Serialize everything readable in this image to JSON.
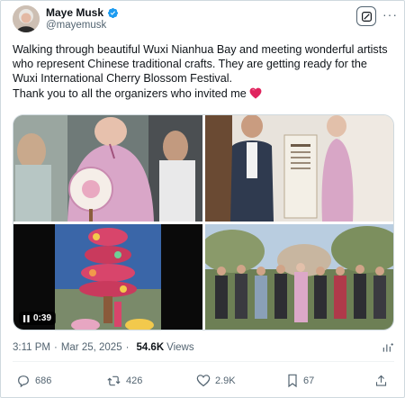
{
  "author": {
    "name": "Maye Musk",
    "handle": "@mayemusk",
    "verified": true
  },
  "header_icons": {
    "grok": "grok-icon",
    "more": "···"
  },
  "tweet": {
    "line1": "Walking through beautiful Wuxi Nianhua Bay and meeting wonderful artists who represent Chinese traditional crafts. They are getting ready for the Wuxi International Cherry Blossom Festival.",
    "line2": "Thank you to all the organizers who invited me",
    "emoji": "heart-icon"
  },
  "media": {
    "video_duration": "0:39",
    "tiles": [
      "photo-woman-with-fan",
      "photo-two-people-by-plaque",
      "video-festival-tower",
      "photo-group-outdoors"
    ]
  },
  "meta": {
    "time": "3:11 PM",
    "date": "Mar 25, 2025",
    "views_count": "54.6K",
    "views_label": "Views"
  },
  "actions": {
    "replies": "686",
    "reposts": "426",
    "likes": "2.9K",
    "bookmarks": "67"
  },
  "colors": {
    "text": "#0f1419",
    "muted": "#536471",
    "verified": "#1d9bf0",
    "heart": "#e0245e",
    "border": "#cfd9de"
  }
}
